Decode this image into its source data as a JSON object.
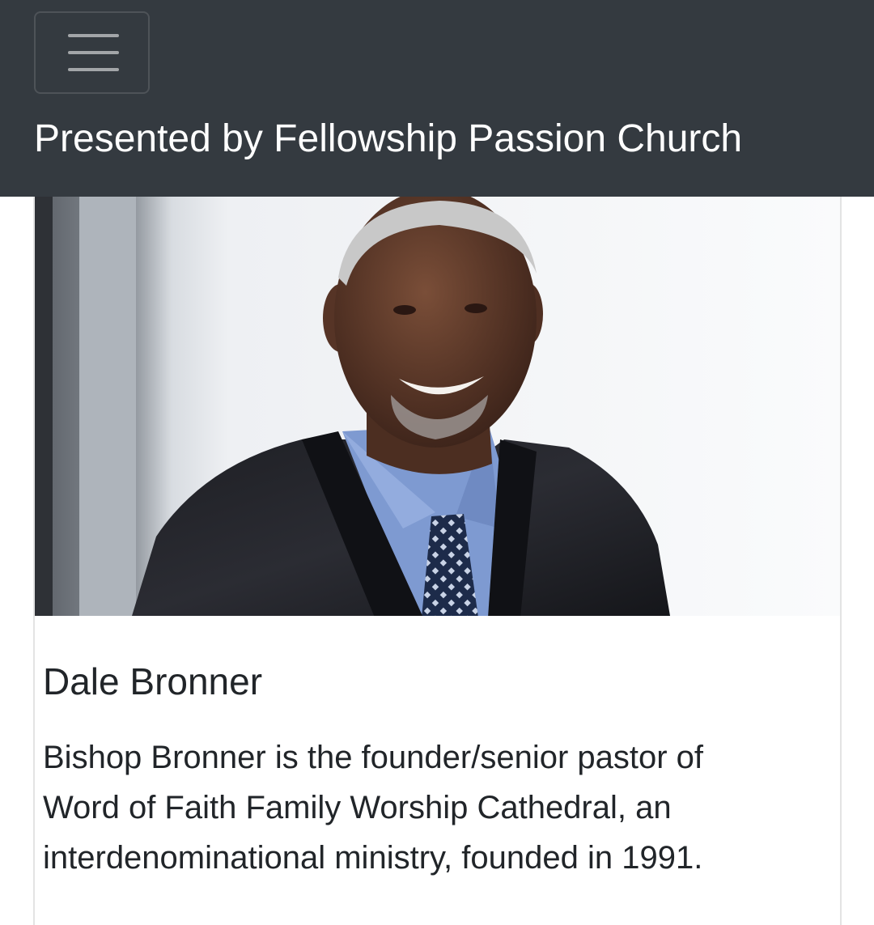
{
  "navbar": {
    "brand": "Presented by Fellowship Passion Church",
    "toggler_icon": "hamburger-menu-icon"
  },
  "card": {
    "image_alt": "Dale Bronner",
    "title": "Dale Bronner",
    "text": "Bishop Bronner is the founder/senior pastor of Word of Faith Family Worship Cathedral, an interdenominational ministry, founded in 1991."
  },
  "colors": {
    "navbar_bg": "#343a40",
    "text": "#212529",
    "navbar_text": "#ffffff"
  }
}
